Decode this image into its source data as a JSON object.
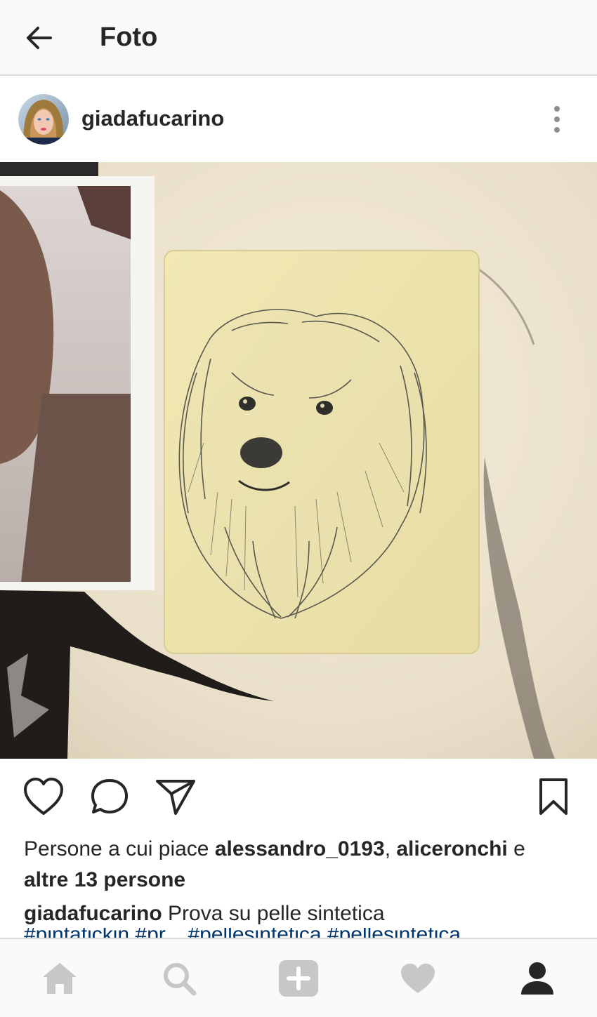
{
  "topbar": {
    "title": "Foto",
    "back_icon": "arrow-left-icon"
  },
  "post": {
    "username": "giadafucarino",
    "avatar_icon": "avatar",
    "more_icon": "more-vertical-icon",
    "photo_subject": "pencil drawing of a dog on synthetic skin"
  },
  "actions": {
    "like_icon": "heart-outline-icon",
    "comment_icon": "comment-icon",
    "share_icon": "send-icon",
    "save_icon": "bookmark-icon"
  },
  "likes": {
    "prefix": "Persone a cui piace ",
    "user1": "alessandro_0193",
    "separator": ", ",
    "user2": "aliceronchi",
    "conjunction": " e",
    "others": "altre 13 persone"
  },
  "caption": {
    "username": "giadafucarino",
    "text": " Prova su pelle sintetica",
    "hashtags": "#pintatickin #pr... #pellesintetica #pellesintetica"
  },
  "bottomnav": {
    "items": [
      {
        "name": "home",
        "icon": "home-icon"
      },
      {
        "name": "search",
        "icon": "search-icon"
      },
      {
        "name": "add",
        "icon": "add-icon"
      },
      {
        "name": "activity",
        "icon": "heart-icon"
      },
      {
        "name": "profile",
        "icon": "profile-icon"
      }
    ],
    "active": "profile"
  },
  "colors": {
    "text": "#262626",
    "inactive_icon": "#c7c7c7",
    "border": "#dbdbdb",
    "hashtag": "#003569",
    "bar_bg": "#fafafa"
  }
}
